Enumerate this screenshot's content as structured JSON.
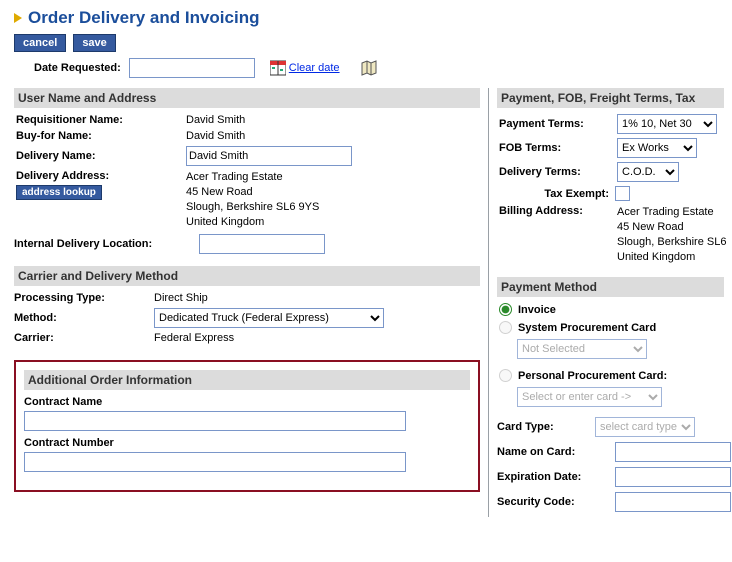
{
  "title": "Order Delivery and Invoicing",
  "buttons": {
    "cancel": "cancel",
    "save": "save",
    "address_lookup": "address lookup"
  },
  "date_requested": {
    "label": "Date Requested:",
    "value": "",
    "clear": "Clear date"
  },
  "sections": {
    "user_address": "User Name and Address",
    "carrier": "Carrier and Delivery Method",
    "additional": "Additional Order Information",
    "payment_terms": "Payment, FOB, Freight Terms, Tax",
    "payment_method": "Payment Method"
  },
  "user_address": {
    "requisitioner_lbl": "Requisitioner Name:",
    "requisitioner": "David Smith",
    "buyfor_lbl": "Buy-for Name:",
    "buyfor": "David Smith",
    "delivery_name_lbl": "Delivery Name:",
    "delivery_name": "David Smith",
    "delivery_addr_lbl": "Delivery Address:",
    "addr1": "Acer Trading Estate",
    "addr2": "45 New Road",
    "addr3": "Slough, Berkshire SL6 9YS",
    "addr4": "United Kingdom",
    "internal_loc_lbl": "Internal Delivery Location:",
    "internal_loc": ""
  },
  "carrier": {
    "processing_lbl": "Processing Type:",
    "processing": "Direct Ship",
    "method_lbl": "Method:",
    "method": "Dedicated Truck (Federal Express)",
    "carrier_lbl": "Carrier:",
    "carrier": "Federal Express"
  },
  "additional": {
    "contract_name_lbl": "Contract Name",
    "contract_name": "",
    "contract_number_lbl": "Contract Number",
    "contract_number": ""
  },
  "terms": {
    "payment_lbl": "Payment Terms:",
    "payment": "1% 10, Net 30",
    "fob_lbl": "FOB Terms:",
    "fob": "Ex Works",
    "delivery_lbl": "Delivery Terms:",
    "delivery": "C.O.D.",
    "tax_lbl": "Tax Exempt:",
    "billing_lbl": "Billing Address:",
    "billing1": "Acer Trading Estate",
    "billing2": "45 New Road",
    "billing3": "Slough, Berkshire SL6",
    "billing4": "United Kingdom"
  },
  "payment_method": {
    "invoice": "Invoice",
    "sys_pcard": "System Procurement Card",
    "sys_pcard_sel": "Not Selected",
    "pers_pcard": "Personal Procurement Card:",
    "pers_pcard_sel": "Select or enter card ->",
    "card_type_lbl": "Card Type:",
    "card_type_ph": "select card type",
    "name_card_lbl": "Name on Card:",
    "name_card": "",
    "exp_lbl": "Expiration Date:",
    "sec_lbl": "Security Code:"
  }
}
